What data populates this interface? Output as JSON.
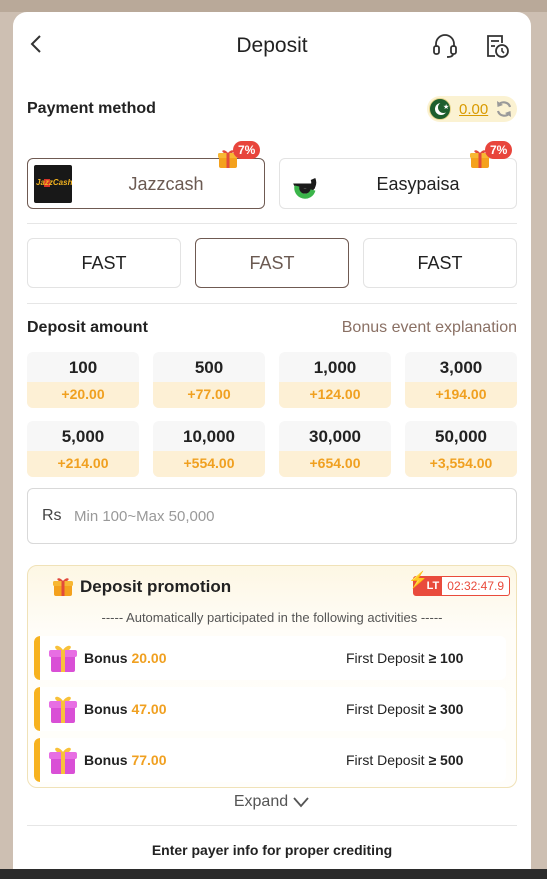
{
  "header": {
    "title": "Deposit"
  },
  "payment": {
    "label": "Payment method",
    "balance": "0.00",
    "methods": [
      {
        "name": "Jazzcash",
        "logo_text": "JazzCash",
        "bonus": "7%",
        "selected": true
      },
      {
        "name": "Easypaisa",
        "bonus": "7%",
        "selected": false
      }
    ],
    "channels": [
      {
        "label": "FAST",
        "selected": false
      },
      {
        "label": "FAST",
        "selected": true
      },
      {
        "label": "FAST",
        "selected": false
      }
    ]
  },
  "deposit": {
    "label": "Deposit amount",
    "bonus_link": "Bonus event explanation",
    "amounts": [
      {
        "value": "100",
        "bonus": "+20.00"
      },
      {
        "value": "500",
        "bonus": "+77.00"
      },
      {
        "value": "1,000",
        "bonus": "+124.00"
      },
      {
        "value": "3,000",
        "bonus": "+194.00"
      },
      {
        "value": "5,000",
        "bonus": "+214.00"
      },
      {
        "value": "10,000",
        "bonus": "+554.00"
      },
      {
        "value": "30,000",
        "bonus": "+654.00"
      },
      {
        "value": "50,000",
        "bonus": "+3,554.00"
      }
    ],
    "currency": "Rs",
    "input_placeholder": "Min 100~Max 50,000",
    "input_value": ""
  },
  "promotion": {
    "title": "Deposit promotion",
    "badge": "LT",
    "timer": "02:32:47.9",
    "note": "----- Automatically participated in the following activities -----",
    "items": [
      {
        "bonus_label": "Bonus",
        "bonus_value": "20.00",
        "cond_label": "First Deposit",
        "cond_sym": "≥",
        "cond_value": "100"
      },
      {
        "bonus_label": "Bonus",
        "bonus_value": "47.00",
        "cond_label": "First Deposit",
        "cond_sym": "≥",
        "cond_value": "300"
      },
      {
        "bonus_label": "Bonus",
        "bonus_value": "77.00",
        "cond_label": "First Deposit",
        "cond_sym": "≥",
        "cond_value": "500"
      }
    ],
    "expand": "Expand"
  },
  "footer": {
    "note": "Enter payer info for proper crediting"
  },
  "colors": {
    "accent": "#f0a020",
    "selected_border": "#6f5a52",
    "badge": "#e8453c",
    "balance": "#d99a00"
  },
  "icons": [
    "back-icon",
    "headset-icon",
    "history-icon",
    "pakistan-flag-icon",
    "refresh-icon",
    "gift-icon",
    "lightning-icon",
    "chevron-down-icon"
  ]
}
